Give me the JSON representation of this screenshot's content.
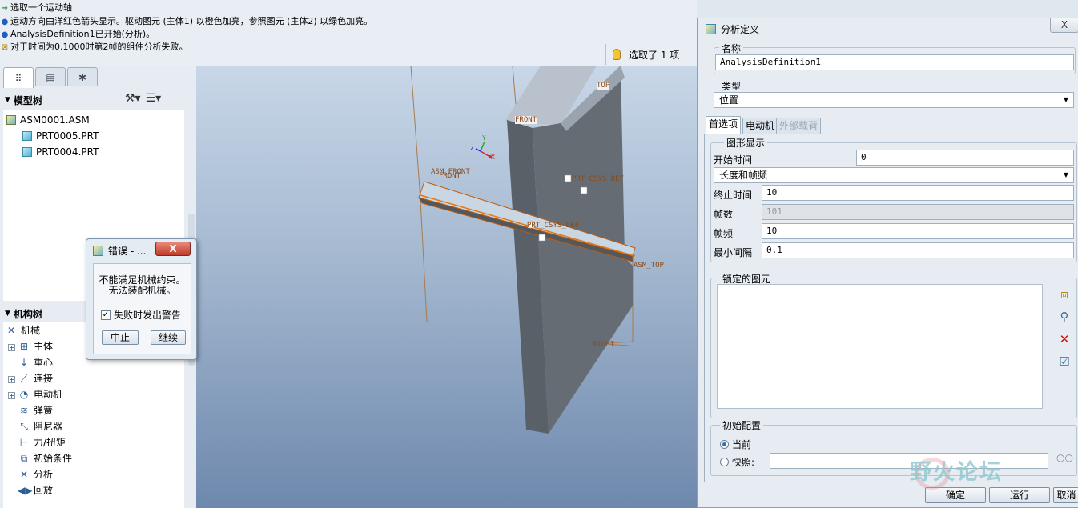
{
  "messages": [
    {
      "icon": "➜",
      "text": "选取一个运动轴"
    },
    {
      "icon": "●",
      "text": "运动方向由洋红色箭头显示。驱动图元 (主体1) 以橙色加亮，参照图元 (主体2) 以绿色加亮。"
    },
    {
      "icon": "●",
      "text": "AnalysisDefinition1已开始(分析)。"
    },
    {
      "icon": "⊠",
      "text": "对于时间为0.1000时第2帧的组件分析失败。"
    }
  ],
  "selection_status": "选取了 1 项",
  "model_tree": {
    "title": "模型树",
    "items": [
      "ASM0001.ASM",
      "PRT0005.PRT",
      "PRT0004.PRT"
    ]
  },
  "mechanism_tree": {
    "title": "机构树",
    "root": "机械",
    "items": [
      "主体",
      "重心",
      "连接",
      "电动机",
      "弹簧",
      "阻尼器",
      "力/扭矩",
      "初始条件",
      "分析",
      "回放"
    ]
  },
  "viewport_labels": {
    "top": "TOP",
    "front": "FRONT",
    "front2": "FRONT",
    "asm_front": "ASM_FRONT",
    "prt_csys_1": "PRT_CSYS_DEF",
    "prt_csys_2": "PRT_CSYS_DEF",
    "asm_top": "ASM_TOP",
    "right": "RIGHT",
    "axis_x": "X",
    "axis_y": "Y",
    "axis_z": "Z"
  },
  "error_dialog": {
    "title": "错误 - ...",
    "close": "X",
    "message_1": "不能满足机械约束。",
    "message_2": "无法装配机械。",
    "checkbox_label": "失败时发出警告",
    "checkbox_checked": true,
    "abort_label": "中止",
    "continue_label": "继续"
  },
  "analysis_dialog": {
    "title": "分析定义",
    "close": "X",
    "name_label": "名称",
    "name_value": "AnalysisDefinition1",
    "type_label": "类型",
    "type_value": "位置",
    "tabs": [
      "首选项",
      "电动机",
      "外部载荷"
    ],
    "graphics_group": "图形显示",
    "start_time_label": "开始时间",
    "start_time_value": "0",
    "mode_value": "长度和帧频",
    "end_time_label": "终止时间",
    "end_time_value": "10",
    "frames_label": "帧数",
    "frames_value": "101",
    "frame_rate_label": "帧频",
    "frame_rate_value": "10",
    "min_interval_label": "最小间隔",
    "min_interval_value": "0.1",
    "locked_group": "锁定的图元",
    "initial_group": "初始配置",
    "current_label": "当前",
    "snapshot_label": "快照:",
    "snapshot_value": "",
    "ok_label": "确定",
    "run_label": "运行",
    "cancel_label": "取消"
  },
  "watermark": "野火论坛"
}
